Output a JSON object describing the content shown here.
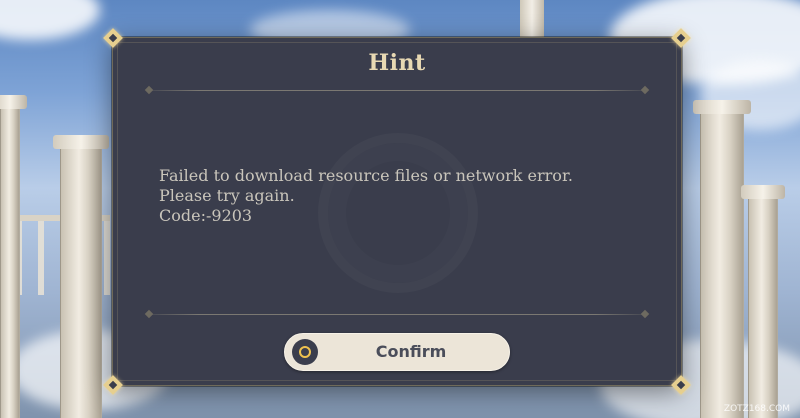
{
  "dialog": {
    "title": "Hint",
    "message_lines": [
      "Failed to download resource files or network error.",
      "Please try again.",
      "Code:-9203"
    ],
    "confirm_label": "Confirm",
    "confirm_icon": "circle-button-icon"
  },
  "watermark": "ZOTZ168.COM",
  "colors": {
    "dialog_bg": "#3a3d4c",
    "title": "#e8d9b3",
    "message": "#c9c5bb",
    "button_bg": "#ece5d8",
    "button_icon_ring": "#efc24f",
    "corner_accent": "#e6cf8f"
  }
}
